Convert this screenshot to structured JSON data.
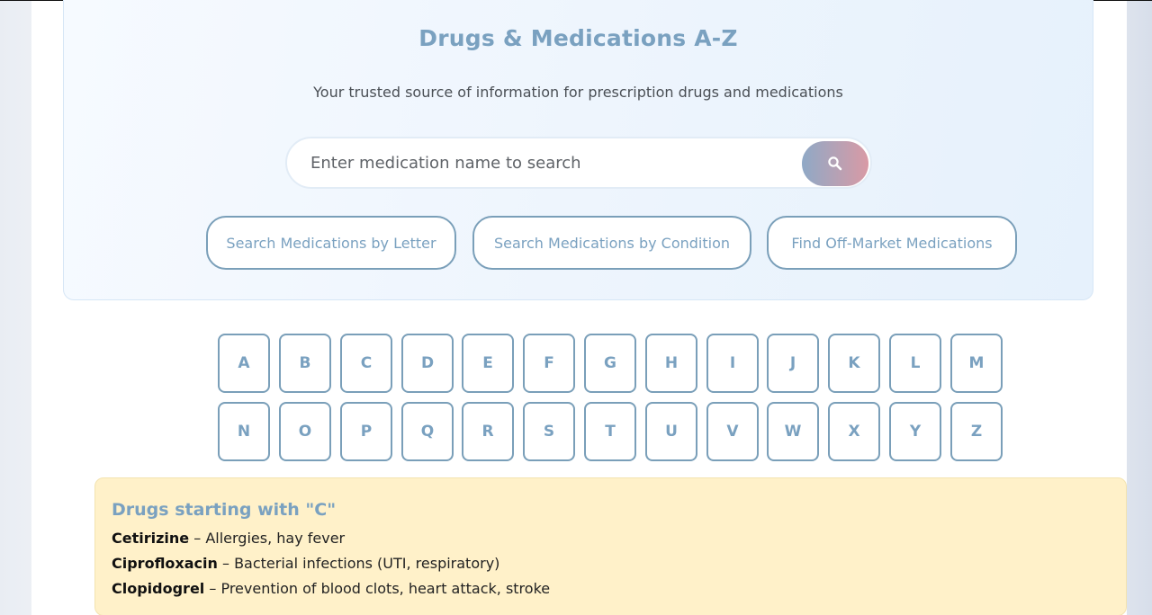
{
  "hero": {
    "title": "Drugs & Medications A-Z",
    "subtitle": "Your trusted source of information for prescription drugs and medications",
    "search": {
      "placeholder": "Enter medication name to search",
      "button_icon": "search-icon"
    },
    "actions": [
      {
        "label": "Search Medications by Letter"
      },
      {
        "label": "Search Medications by Condition"
      },
      {
        "label": "Find Off-Market Medications"
      }
    ]
  },
  "letters": {
    "row1": [
      "A",
      "B",
      "C",
      "D",
      "E",
      "F",
      "G",
      "H",
      "I",
      "J",
      "K",
      "L",
      "M"
    ],
    "row2": [
      "N",
      "O",
      "P",
      "Q",
      "R",
      "S",
      "T",
      "U",
      "V",
      "W",
      "X",
      "Y",
      "Z"
    ]
  },
  "results": {
    "title": "Drugs starting with \"C\"",
    "items": [
      {
        "name": "Cetirizine",
        "desc": " – Allergies, hay fever"
      },
      {
        "name": "Ciprofloxacin",
        "desc": " – Bacterial infections (UTI, respiratory)"
      },
      {
        "name": "Clopidogrel",
        "desc": " – Prevention of blood clots, heart attack, stroke"
      }
    ]
  },
  "colors": {
    "accent": "#7aa1c0",
    "border": "#7a9fb9",
    "results_bg": "#fff1c9",
    "search_gradient_start": "#8fa9c6",
    "search_gradient_end": "#d99aa5"
  }
}
